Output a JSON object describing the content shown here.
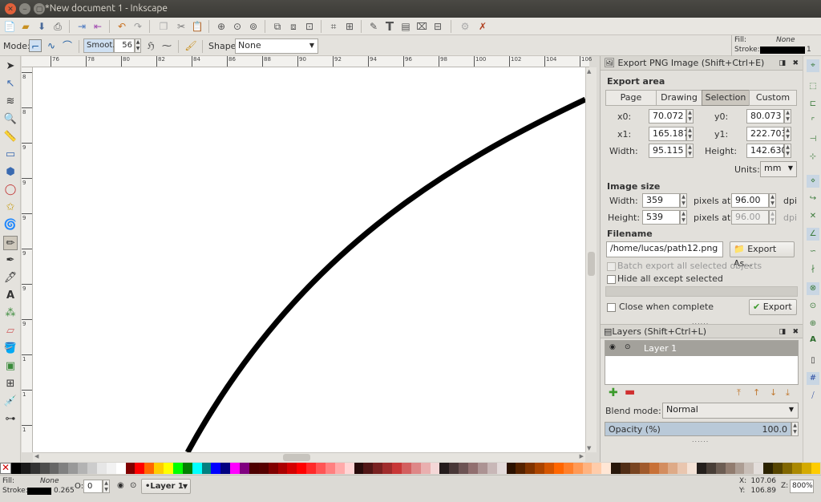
{
  "window": {
    "title": "*New document 1 - Inkscape"
  },
  "ctrl": {
    "mode_label": "Mode:",
    "smooth_label": "Smoot...",
    "smooth_value": "56",
    "shape_label": "Shape:",
    "shape_value": "None",
    "fill_label": "Fill:",
    "fill_value": "None",
    "stroke_label": "Stroke:",
    "stroke_width": "1"
  },
  "ruler": {
    "h_ticks": [
      "76",
      "78",
      "80",
      "82",
      "84",
      "86",
      "88",
      "90",
      "92",
      "94",
      "96",
      "98",
      "100",
      "102",
      "104",
      "106"
    ],
    "v_ticks": [
      "8",
      "8",
      "9",
      "9",
      "9",
      "9",
      "9",
      "9",
      "1",
      "1",
      "1"
    ]
  },
  "export": {
    "header": "Export PNG Image (Shift+Ctrl+E)",
    "area_title": "Export area",
    "tabs": [
      "Page",
      "Drawing",
      "Selection",
      "Custom"
    ],
    "active_tab": "Selection",
    "x0_label": "x0:",
    "x0": "70.072",
    "y0_label": "y0:",
    "y0": "80.073",
    "x1_label": "x1:",
    "x1": "165.187",
    "y1_label": "y1:",
    "y1": "222.703",
    "width_label": "Width:",
    "width": "95.115",
    "height_label": "Height:",
    "height": "142.630",
    "units_label": "Units:",
    "units": "mm",
    "image_size_title": "Image size",
    "img_width_label": "Width:",
    "img_width": "359",
    "img_height_label": "Height:",
    "img_height": "539",
    "pixels_at": "pixels at",
    "dpi_w": "96.00",
    "dpi_h": "96.00",
    "dpi": "dpi",
    "filename_title": "Filename",
    "filename": "/home/lucas/path12.png",
    "export_as": "Export As...",
    "batch": "Batch export all selected objects",
    "hide_all": "Hide all except selected",
    "close_when": "Close when complete",
    "export_btn": "Export"
  },
  "layers": {
    "header": "Layers (Shift+Ctrl+L)",
    "items": [
      "Layer 1"
    ],
    "blend_label": "Blend mode:",
    "blend_value": "Normal",
    "opacity_label": "Opacity (%)",
    "opacity_value": "100.0",
    "opacity_fraction": 1.0
  },
  "status": {
    "fill_label": "Fill:",
    "fill_value": "None",
    "stroke_label": "Stroke:",
    "stroke_width": "0.265",
    "o_label": "O:",
    "o_value": "0",
    "layer": "•Layer 1",
    "x_label": "X:",
    "x_value": "107.06",
    "y_label": "Y:",
    "y_value": "106.89",
    "z_label": "Z:",
    "zoom": "800%"
  },
  "palette": [
    "#000000",
    "#1a1a1a",
    "#333333",
    "#4d4d4d",
    "#666666",
    "#808080",
    "#999999",
    "#b3b3b3",
    "#cccccc",
    "#e6e6e6",
    "#f2f2f2",
    "#ffffff",
    "#800000",
    "#ff0000",
    "#ff6600",
    "#ffcc00",
    "#ffff00",
    "#00ff00",
    "#008000",
    "#00ffff",
    "#008080",
    "#0000ff",
    "#000080",
    "#ff00ff",
    "#800080",
    "#4d0000",
    "#550000",
    "#800000",
    "#aa0000",
    "#d40000",
    "#ff0000",
    "#ff2a2a",
    "#ff5555",
    "#ff8080",
    "#ffaaaa",
    "#ffd5d5",
    "#280b0b",
    "#501616",
    "#782121",
    "#a02c2c",
    "#c83737",
    "#d35f5f",
    "#de8787",
    "#e9afaf",
    "#f4d7d7",
    "#241c1c",
    "#483737",
    "#6c5353",
    "#916f6f",
    "#ac9393",
    "#c8b7b7",
    "#e3dbdb",
    "#2b1100",
    "#552200",
    "#803300",
    "#aa4400",
    "#d45500",
    "#ff6600",
    "#ff7f2a",
    "#ff9955",
    "#ffb380",
    "#ffccaa",
    "#ffe6d5",
    "#28170b",
    "#502d16",
    "#784421",
    "#a05a2c",
    "#c87137",
    "#d38d5f",
    "#deaa87",
    "#e9c6af",
    "#f4e3d7",
    "#241f1c",
    "#483e37",
    "#6c5d53",
    "#917c6f",
    "#ac9d93",
    "#c8beb7",
    "#e3dedb",
    "#2b2200",
    "#554400",
    "#806600",
    "#aa8800",
    "#d4aa00",
    "#ffcc00"
  ]
}
